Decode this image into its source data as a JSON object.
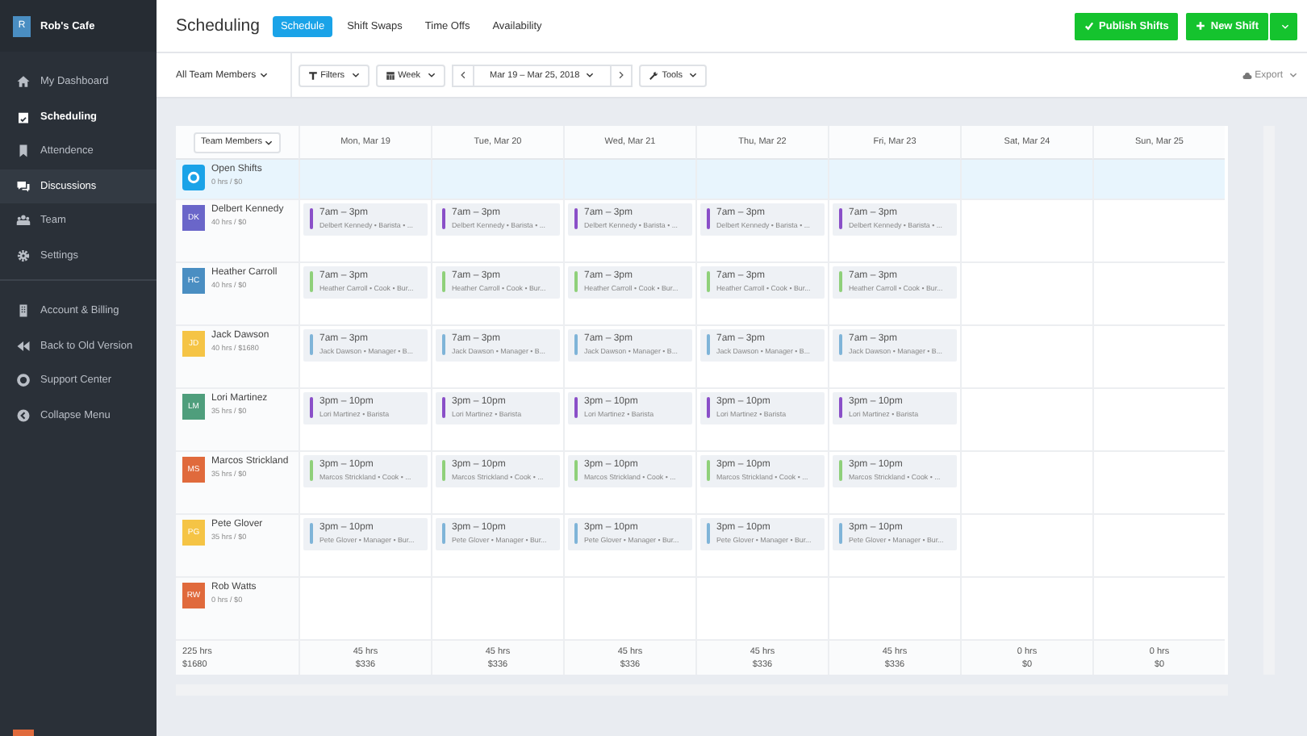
{
  "brand": {
    "initial": "R",
    "name": "Rob's Cafe"
  },
  "sidebar": {
    "items": [
      {
        "label": "My Dashboard",
        "selected": false,
        "highlighted": false
      },
      {
        "label": "Scheduling",
        "selected": true,
        "highlighted": false
      },
      {
        "label": "Attendence",
        "selected": false,
        "highlighted": false
      },
      {
        "label": "Discussions",
        "selected": false,
        "highlighted": true
      },
      {
        "label": "Team",
        "selected": false,
        "highlighted": false
      },
      {
        "label": "Settings",
        "selected": false,
        "highlighted": false
      }
    ],
    "secondary_items": [
      {
        "label": "Account & Billing"
      },
      {
        "label": "Back to Old Version"
      },
      {
        "label": "Support Center"
      },
      {
        "label": "Collapse Menu"
      }
    ]
  },
  "header": {
    "title": "Scheduling",
    "tabs": [
      {
        "label": "Schedule",
        "selected": true
      },
      {
        "label": "Shift Swaps",
        "selected": false
      },
      {
        "label": "Time Offs",
        "selected": false
      },
      {
        "label": "Availability",
        "selected": false
      }
    ],
    "publish_button": "Publish Shifts",
    "new_shift_button": "New Shift"
  },
  "toolbar": {
    "member_filter": "All Team Members",
    "filters": "Filters",
    "view": "Week",
    "date_range": "Mar 19 – Mar 25, 2018",
    "tools": "Tools",
    "export": "Export"
  },
  "table": {
    "member_column": "Team Members",
    "days": [
      "Mon, Mar 19",
      "Tue, Mar 20",
      "Wed, Mar 21",
      "Thu, Mar 22",
      "Fri, Mar 23",
      "Sat, Mar 24",
      "Sun, Mar 25"
    ],
    "open_shifts": {
      "name": "Open Shifts",
      "summary": "0 hrs / $0"
    },
    "members": [
      {
        "initials": "DK",
        "name": "Delbert Kennedy",
        "summary": "40 hrs / $0",
        "color": "#6a66c9",
        "shifts": [
          {
            "time": "7am – 3pm",
            "detail": "Delbert Kennedy • Barista • ...",
            "color": "#8a4fc8"
          },
          {
            "time": "7am – 3pm",
            "detail": "Delbert Kennedy • Barista • ...",
            "color": "#8a4fc8"
          },
          {
            "time": "7am – 3pm",
            "detail": "Delbert Kennedy • Barista • ...",
            "color": "#8a4fc8"
          },
          {
            "time": "7am – 3pm",
            "detail": "Delbert Kennedy • Barista • ...",
            "color": "#8a4fc8"
          },
          {
            "time": "7am – 3pm",
            "detail": "Delbert Kennedy • Barista • ...",
            "color": "#8a4fc8"
          }
        ]
      },
      {
        "initials": "HC",
        "name": "Heather Carroll",
        "summary": "40 hrs / $0",
        "color": "#4a8ec2",
        "shifts": [
          {
            "time": "7am – 3pm",
            "detail": "Heather Carroll • Cook • Bur...",
            "color": "#8fd07a"
          },
          {
            "time": "7am – 3pm",
            "detail": "Heather Carroll • Cook • Bur...",
            "color": "#8fd07a"
          },
          {
            "time": "7am – 3pm",
            "detail": "Heather Carroll • Cook • Bur...",
            "color": "#8fd07a"
          },
          {
            "time": "7am – 3pm",
            "detail": "Heather Carroll • Cook • Bur...",
            "color": "#8fd07a"
          },
          {
            "time": "7am – 3pm",
            "detail": "Heather Carroll • Cook • Bur...",
            "color": "#8fd07a"
          }
        ]
      },
      {
        "initials": "JD",
        "name": "Jack Dawson",
        "summary": "40 hrs / $1680",
        "color": "#f5c445",
        "shifts": [
          {
            "time": "7am – 3pm",
            "detail": "Jack Dawson • Manager • B...",
            "color": "#7fb4d8"
          },
          {
            "time": "7am – 3pm",
            "detail": "Jack Dawson • Manager • B...",
            "color": "#7fb4d8"
          },
          {
            "time": "7am – 3pm",
            "detail": "Jack Dawson • Manager • B...",
            "color": "#7fb4d8"
          },
          {
            "time": "7am – 3pm",
            "detail": "Jack Dawson • Manager • B...",
            "color": "#7fb4d8"
          },
          {
            "time": "7am – 3pm",
            "detail": "Jack Dawson • Manager • B...",
            "color": "#7fb4d8"
          }
        ]
      },
      {
        "initials": "LM",
        "name": "Lori Martinez",
        "summary": "35 hrs / $0",
        "color": "#4f9e7c",
        "shifts": [
          {
            "time": "3pm – 10pm",
            "detail": "Lori Martinez • Barista",
            "color": "#8a4fc8"
          },
          {
            "time": "3pm – 10pm",
            "detail": "Lori Martinez • Barista",
            "color": "#8a4fc8"
          },
          {
            "time": "3pm – 10pm",
            "detail": "Lori Martinez • Barista",
            "color": "#8a4fc8"
          },
          {
            "time": "3pm – 10pm",
            "detail": "Lori Martinez • Barista",
            "color": "#8a4fc8"
          },
          {
            "time": "3pm – 10pm",
            "detail": "Lori Martinez • Barista",
            "color": "#8a4fc8"
          }
        ]
      },
      {
        "initials": "MS",
        "name": "Marcos Strickland",
        "summary": "35 hrs / $0",
        "color": "#e06a3c",
        "shifts": [
          {
            "time": "3pm – 10pm",
            "detail": "Marcos Strickland • Cook • ...",
            "color": "#8fd07a"
          },
          {
            "time": "3pm – 10pm",
            "detail": "Marcos Strickland • Cook • ...",
            "color": "#8fd07a"
          },
          {
            "time": "3pm – 10pm",
            "detail": "Marcos Strickland • Cook • ...",
            "color": "#8fd07a"
          },
          {
            "time": "3pm – 10pm",
            "detail": "Marcos Strickland • Cook • ...",
            "color": "#8fd07a"
          },
          {
            "time": "3pm – 10pm",
            "detail": "Marcos Strickland • Cook • ...",
            "color": "#8fd07a"
          }
        ]
      },
      {
        "initials": "PG",
        "name": "Pete Glover",
        "summary": "35 hrs / $0",
        "color": "#f5c445",
        "shifts": [
          {
            "time": "3pm – 10pm",
            "detail": "Pete Glover • Manager • Bur...",
            "color": "#7fb4d8"
          },
          {
            "time": "3pm – 10pm",
            "detail": "Pete Glover • Manager • Bur...",
            "color": "#7fb4d8"
          },
          {
            "time": "3pm – 10pm",
            "detail": "Pete Glover • Manager • Bur...",
            "color": "#7fb4d8"
          },
          {
            "time": "3pm – 10pm",
            "detail": "Pete Glover • Manager • Bur...",
            "color": "#7fb4d8"
          },
          {
            "time": "3pm – 10pm",
            "detail": "Pete Glover • Manager • Bur...",
            "color": "#7fb4d8"
          }
        ]
      },
      {
        "initials": "RW",
        "name": "Rob Watts",
        "summary": "0 hrs / $0",
        "color": "#e06a3c"
      }
    ],
    "totals": {
      "hours": "225 hrs",
      "cost": "$1680",
      "days": [
        {
          "hours": "45 hrs",
          "cost": "$336"
        },
        {
          "hours": "45 hrs",
          "cost": "$336"
        },
        {
          "hours": "45 hrs",
          "cost": "$336"
        },
        {
          "hours": "45 hrs",
          "cost": "$336"
        },
        {
          "hours": "45 hrs",
          "cost": "$336"
        },
        {
          "hours": "0 hrs",
          "cost": "$0"
        },
        {
          "hours": "0 hrs",
          "cost": "$0"
        }
      ]
    }
  }
}
